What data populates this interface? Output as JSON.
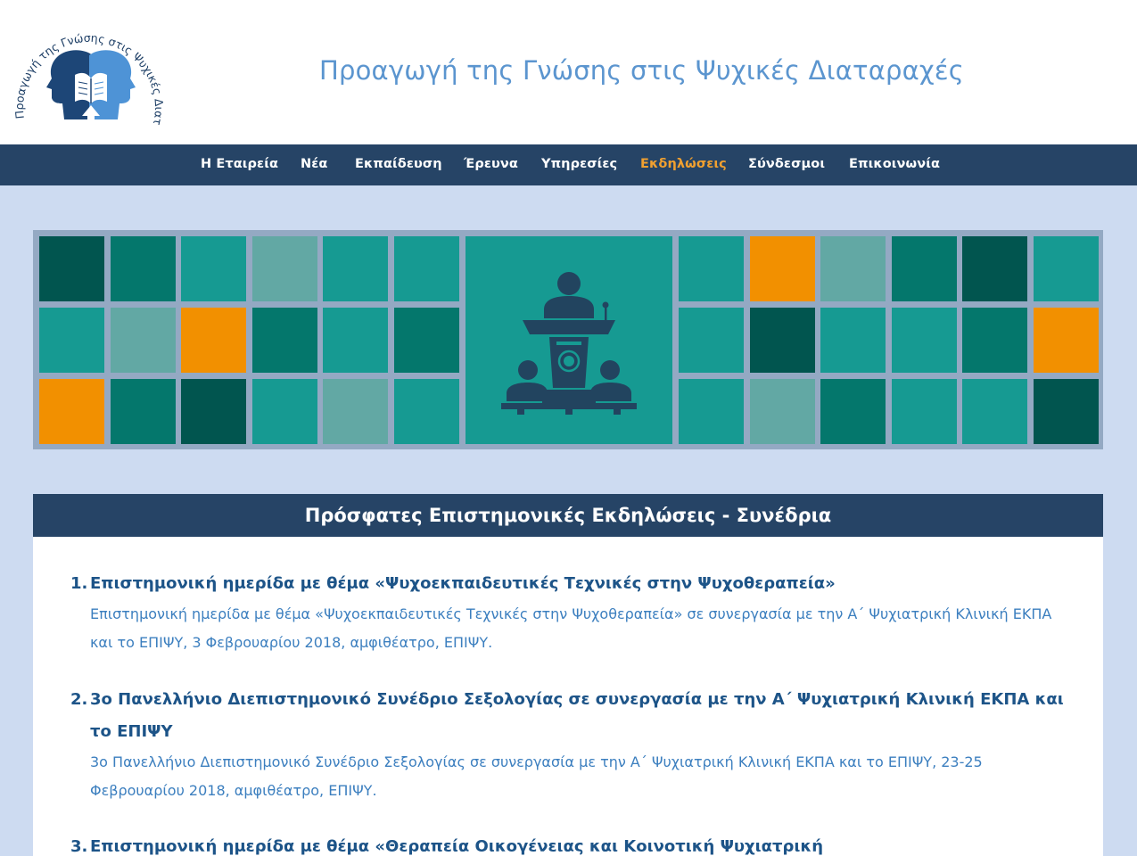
{
  "header": {
    "logo_text": "Προαγωγή της Γνώσης στις Ψυχικές Διαταραχές",
    "title": "Προαγωγή της Γνώσης στις Ψυχικές Διαταραχές"
  },
  "nav": {
    "items": [
      {
        "label": "Η Εταιρεία"
      },
      {
        "label": "Νέα"
      },
      {
        "label": "Εκπαίδευση"
      },
      {
        "label": "Έρευνα"
      },
      {
        "label": "Υπηρεσίες"
      },
      {
        "label": "Εκδηλώσεις",
        "active": true
      },
      {
        "label": "Σύνδεσμοι"
      },
      {
        "label": "Επικοινωνία"
      }
    ]
  },
  "banner": {
    "icon": "conference-speaker-icon",
    "tile_colors": [
      "#01554f",
      "#04776c",
      "#169a92",
      "#62a8a4",
      "#f29000"
    ]
  },
  "events": {
    "title": "Πρόσφατες Επιστημονικές Εκδηλώσεις - Συνέδρια",
    "items": [
      {
        "number": "1.",
        "title": "Επιστημονική ημερίδα με θέμα «Ψυχοεκπαιδευτικές Τεχνικές στην Ψυχοθεραπεία»",
        "desc_line1": "Επιστημονική ημερίδα με θέμα «Ψυχοεκπαιδευτικές Τεχνικές στην Ψυχοθεραπεία» σε συνεργασία με την Α΄ Ψυχιατρική Κλινική ΕΚΠΑ",
        "desc_line2": "και το ΕΠΙΨΥ, 3 Φεβρουαρίου 2018, αμφιθέατρο, ΕΠΙΨΥ."
      },
      {
        "number": "2.",
        "title_line1": "3ο Πανελλήνιο Διεπιστημονικό Συνέδριο Σεξολογίας σε συνεργασία με την Α΄ Ψυχιατρική Κλινική ΕΚΠΑ και",
        "title_line2": "το ΕΠΙΨΥ",
        "desc_line1": "3ο Πανελλήνιο Διεπιστημονικό Συνέδριο Σεξολογίας σε συνεργασία με την Α΄ Ψυχιατρική Κλινική ΕΚΠΑ και το ΕΠΙΨΥ, 23-25",
        "desc_line2": "Φεβρουαρίου 2018, αμφιθέατρο, ΕΠΙΨΥ."
      },
      {
        "number": "3.",
        "title": "Επιστημονική ημερίδα με θέμα «Θεραπεία Οικογένειας και Κοινοτική Ψυχιατρική"
      }
    ]
  }
}
